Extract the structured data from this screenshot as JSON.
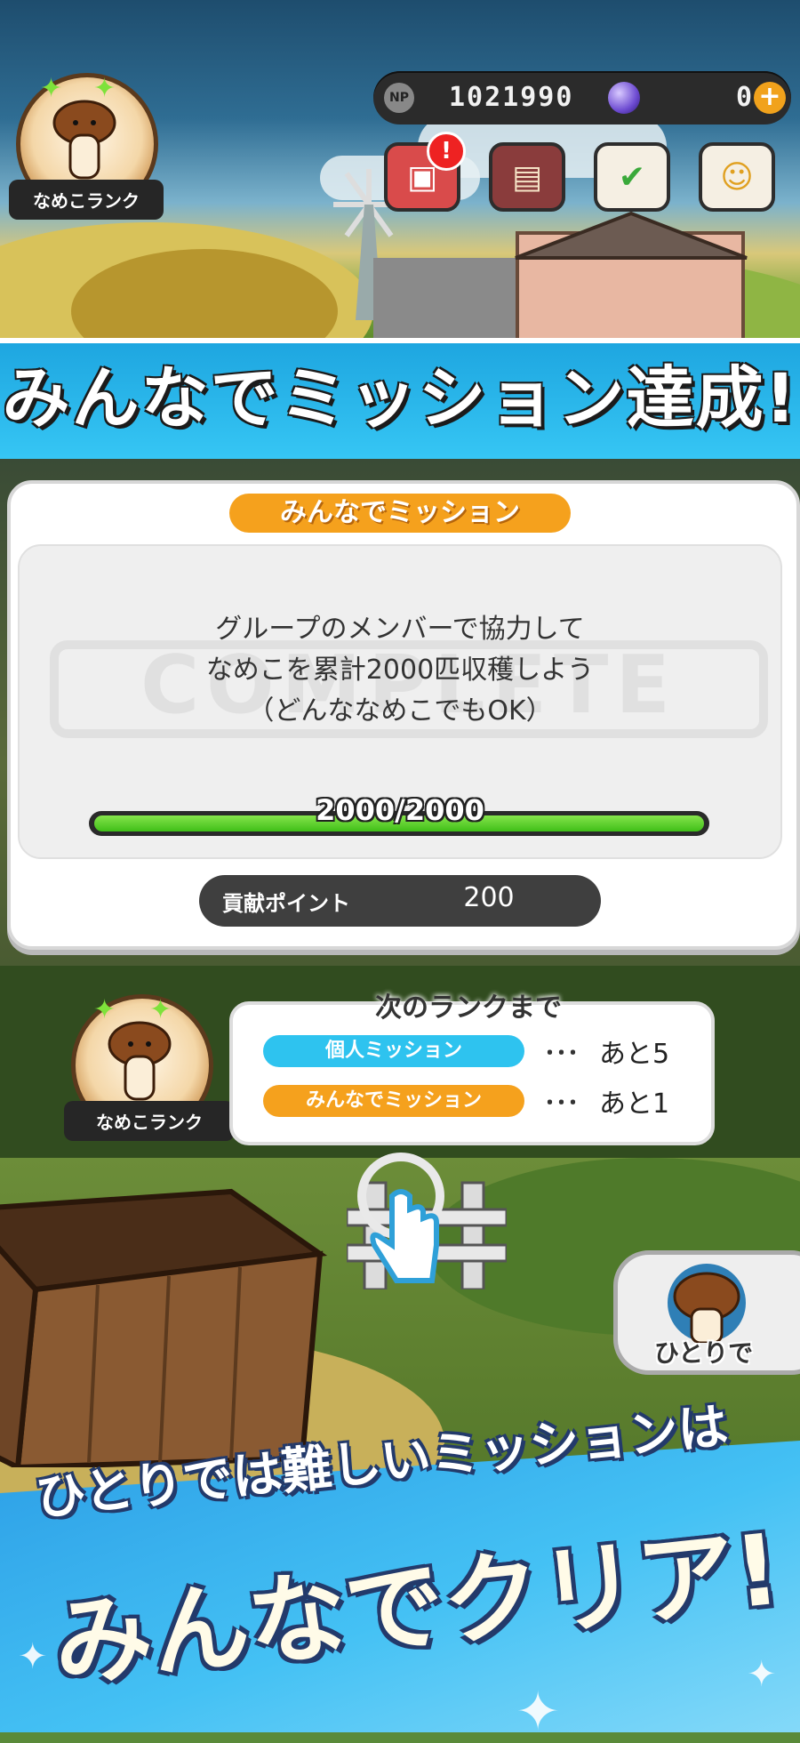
{
  "status_bar": {
    "np_label": "NP",
    "np_value": "1021990",
    "gem_value": "0",
    "plus_label": "+"
  },
  "header_icons": [
    {
      "name": "tv-alert-icon",
      "badge": "!"
    },
    {
      "name": "album-icon"
    },
    {
      "name": "checklist-icon"
    },
    {
      "name": "chat-icon"
    }
  ],
  "top_rank_label": "なめこランク",
  "banner_title": "みんなでミッション達成!",
  "mission_card": {
    "title": "みんなでミッション",
    "watermark": "COMPLETE",
    "description": [
      "グループのメンバーで協力して",
      "なめこを累計2000匹収穫しよう",
      "（どんななめこでもOK）"
    ],
    "progress_current": 2000,
    "progress_total": 2000,
    "progress_text": "2000/2000",
    "contribution_label": "貢献ポイント",
    "contribution_value": "200"
  },
  "next_rank": {
    "title": "次のランクまで",
    "rank_label": "なめこランク",
    "rows": [
      {
        "label": "個人ミッション",
        "dots": "･･･",
        "remaining": "あと5",
        "color": "#2ec3ef"
      },
      {
        "label": "みんなでミッション",
        "dots": "･･･",
        "remaining": "あと1",
        "color": "#f5a11d"
      }
    ]
  },
  "solo_button_label": "ひとりで",
  "tagline": {
    "line1": "ひとりでは難しいミッションは",
    "line2": "みんなでクリア!"
  },
  "colors": {
    "banner_bg": "#1ea6e0",
    "accent_orange": "#f5a11d",
    "accent_cyan": "#2ec3ef",
    "progress_green": "#3fbf18"
  }
}
